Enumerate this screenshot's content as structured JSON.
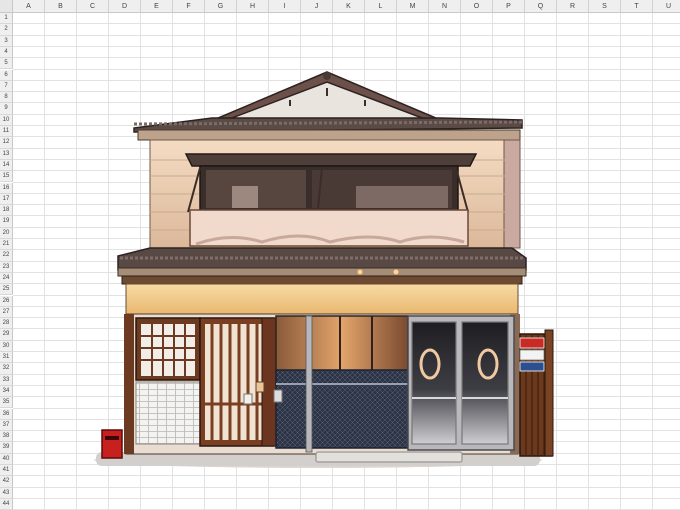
{
  "sheet": {
    "columns": [
      "A",
      "B",
      "C",
      "D",
      "E",
      "F",
      "G",
      "H",
      "I",
      "J",
      "K",
      "L",
      "M",
      "N",
      "O",
      "P",
      "Q",
      "R",
      "S",
      "T",
      "U"
    ],
    "rows": [
      "1",
      "2",
      "3",
      "4",
      "5",
      "6",
      "7",
      "8",
      "9",
      "10",
      "11",
      "12",
      "13",
      "14",
      "15",
      "16",
      "17",
      "18",
      "19",
      "20",
      "21",
      "22",
      "23",
      "24",
      "25",
      "26",
      "27",
      "28",
      "29",
      "30",
      "31",
      "32",
      "33",
      "34",
      "35",
      "36",
      "37",
      "38",
      "39",
      "40",
      "41",
      "42",
      "43",
      "44"
    ]
  },
  "image": {
    "subject_icon": "japanese-storefront-illustration",
    "colors": {
      "roof": "#5a4a46",
      "wall": "#eacdb0",
      "awning": "#f3cf8e",
      "wood": "#6b3a20",
      "glass": "#2e2e33",
      "tile": "#f1f1ef",
      "mailbox": "#c8201e"
    }
  }
}
